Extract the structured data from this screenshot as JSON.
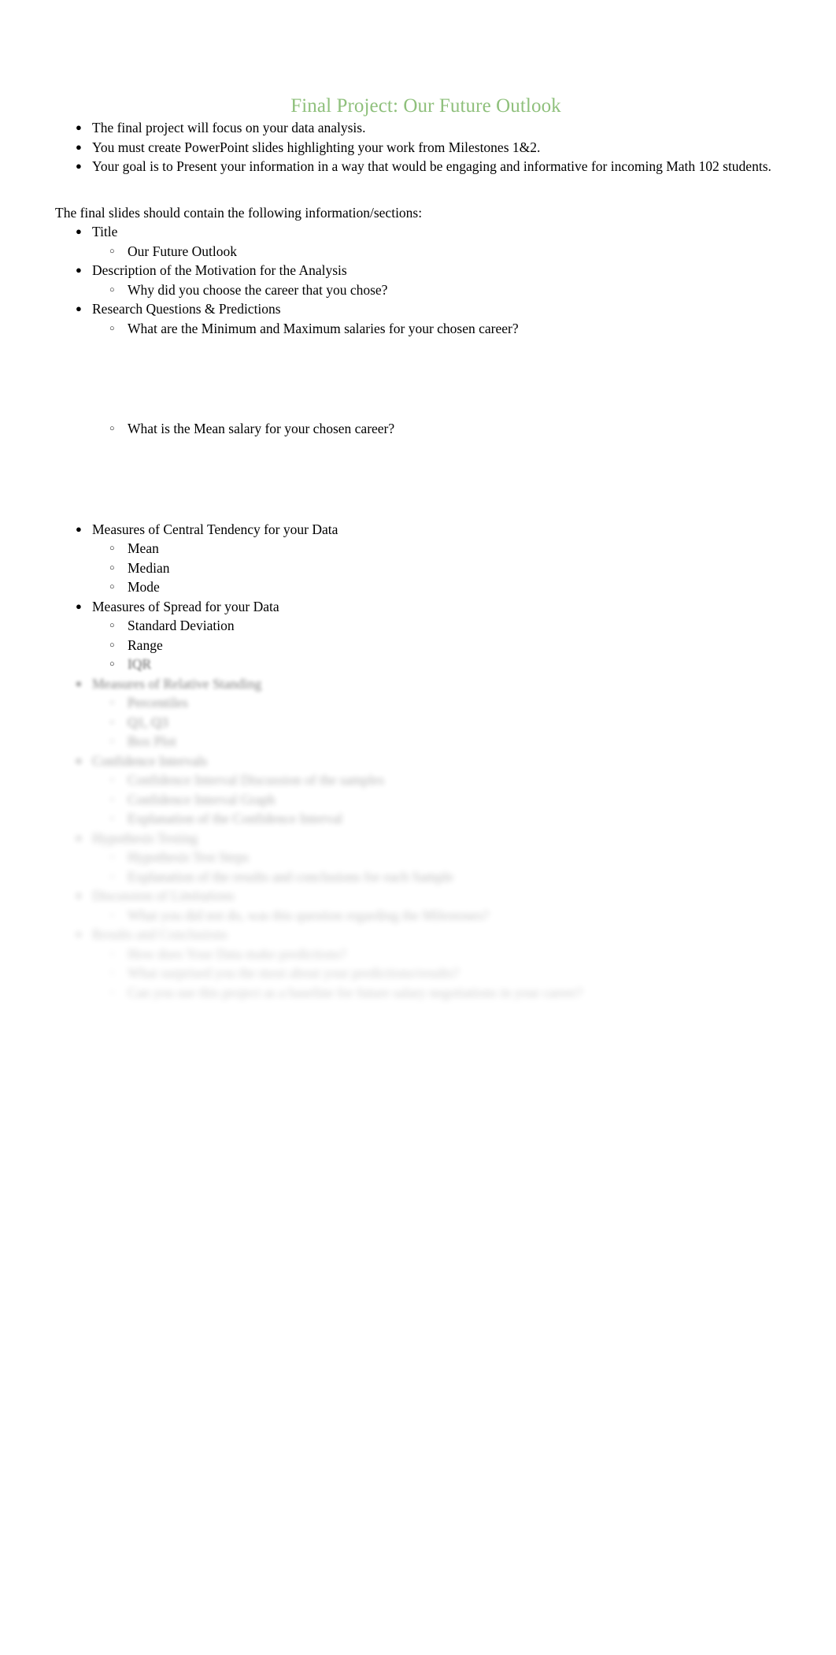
{
  "document": {
    "title": "Final Project: Our Future Outlook",
    "title_color": "#8FC07C",
    "body_color": "#000000",
    "background_color": "#ffffff"
  },
  "intro_list": {
    "items": [
      "The final project will focus on your data analysis.",
      "You must create PowerPoint slides highlighting your work from Milestones 1&2.",
      "Your goal is to Present your information in a way that would be engaging and informative for incoming Math 102 students."
    ]
  },
  "lead_in": {
    "text": "The final slides should contain the following information/sections:"
  },
  "sections": [
    {
      "label": "Title",
      "sub": [
        "Our Future Outlook"
      ]
    },
    {
      "label": "Description of the Motivation for the Analysis",
      "sub": [
        "Why did you choose the career that you chose?"
      ]
    },
    {
      "label": "Research Questions & Predictions",
      "sub": [
        "What are the Minimum and Maximum salaries for your chosen career?",
        "What is the Mean salary for your chosen career?"
      ]
    },
    {
      "label": "Measures of Central Tendency for your Data",
      "sub": [
        "Mean",
        "Median",
        "Mode"
      ]
    },
    {
      "label": "Measures of Spread for your Data",
      "sub": [
        "Standard Deviation",
        "Range",
        "IQR"
      ]
    },
    {
      "label": "Measures of Relative Standing",
      "sub": [
        "Percentiles",
        "Q1, Q3",
        "Box Plot"
      ]
    },
    {
      "label": "Confidence Intervals",
      "sub": [
        "Confidence Interval Discussion of the samples",
        "Confidence Interval Graph",
        "Explanation of the Confidence Interval"
      ]
    },
    {
      "label": "Hypothesis Testing",
      "sub": [
        "Hypothesis Test Steps",
        "Explanation of the results and conclusions for each Sample"
      ]
    },
    {
      "label": "Discussion of Limitations",
      "sub": [
        "What you did not do, was this question regarding the Milestones?"
      ]
    },
    {
      "label": "Results and Conclusions",
      "sub": [
        "How does Your Data make predictions?",
        "What surprised you the most about your predictions/results?",
        "Can you use this project as a baseline for future salary negotiations in your career?"
      ]
    }
  ],
  "glyphs": {
    "bullet_level1": "●",
    "bullet_level2": "○"
  }
}
